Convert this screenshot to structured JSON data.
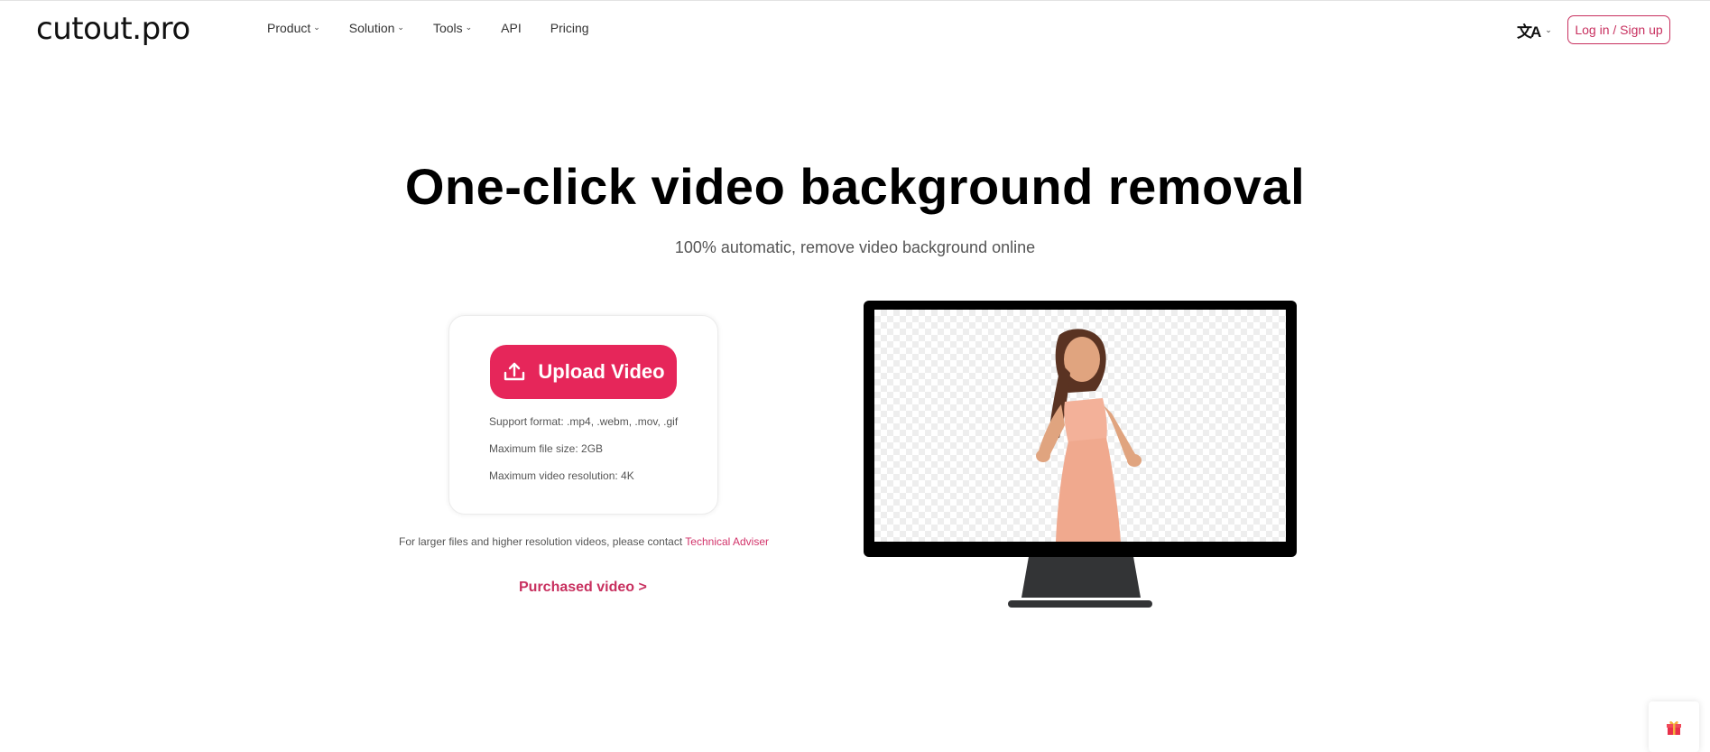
{
  "header": {
    "logo": "cutout.pro",
    "nav": [
      {
        "label": "Product",
        "has_dropdown": true
      },
      {
        "label": "Solution",
        "has_dropdown": true
      },
      {
        "label": "Tools",
        "has_dropdown": true
      },
      {
        "label": "API",
        "has_dropdown": false
      },
      {
        "label": "Pricing",
        "has_dropdown": false
      }
    ],
    "language_icon": "translate-icon",
    "login_label": "Log in / Sign up"
  },
  "hero": {
    "title": "One-click video background removal",
    "subtitle": "100% automatic, remove video background online"
  },
  "upload": {
    "button_label": "Upload Video",
    "button_icon": "upload-icon",
    "specs": [
      "Support format: .mp4, .webm, .mov, .gif",
      "Maximum file size: 2GB",
      "Maximum video resolution: 4K"
    ],
    "contact_text": "For larger files and higher resolution videos, please contact ",
    "contact_link": "Technical Adviser",
    "purchased_label": "Purchased video >"
  },
  "floating": {
    "gift_icon": "gift-icon"
  },
  "colors": {
    "brand": "#e6265a",
    "link": "#c8305f"
  }
}
